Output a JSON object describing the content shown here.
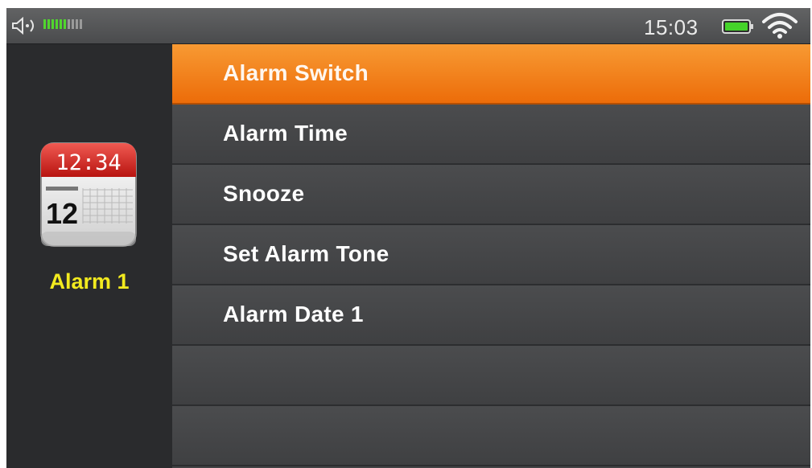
{
  "status_bar": {
    "time": "15:03",
    "icons": [
      "speaker-icon",
      "volume-level-icon",
      "battery-icon",
      "wifi-icon"
    ],
    "volume_level": 0.6,
    "accent_green": "#51d62e"
  },
  "sidebar": {
    "icon": "calendar-clock-icon",
    "icon_time": "12:34",
    "icon_day": "12",
    "label": "Alarm 1",
    "label_color": "#f2ea1f"
  },
  "menu": {
    "selected_index": 0,
    "selected_color": "#f07a15",
    "items": [
      {
        "label": "Alarm Switch"
      },
      {
        "label": "Alarm Time"
      },
      {
        "label": "Snooze"
      },
      {
        "label": "Set Alarm Tone"
      },
      {
        "label": "Alarm Date 1"
      },
      {
        "label": ""
      },
      {
        "label": ""
      }
    ]
  }
}
